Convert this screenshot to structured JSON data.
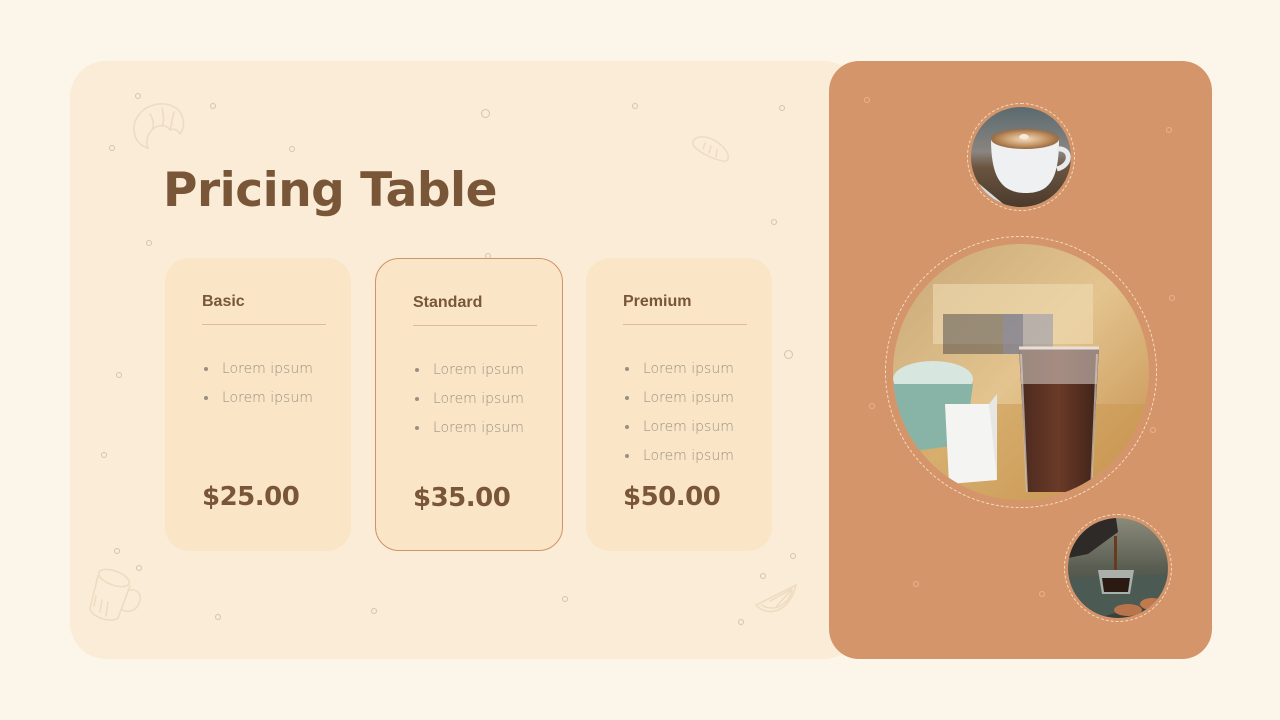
{
  "slide": {
    "title": "Pricing Table",
    "colors": {
      "background": "#fcf6ea",
      "left_panel": "#faecd6",
      "right_panel": "#d4956a",
      "card": "#fae6c6",
      "accent_border": "#cf9468",
      "heading_text": "#7a5638",
      "body_text": "#9a9082"
    }
  },
  "plans": [
    {
      "name": "Basic",
      "features": [
        "Lorem ipsum",
        "Lorem ipsum"
      ],
      "price": "$25.00",
      "featured": false
    },
    {
      "name": "Standard",
      "features": [
        "Lorem ipsum",
        "Lorem ipsum",
        "Lorem ipsum"
      ],
      "price": "$35.00",
      "featured": true
    },
    {
      "name": "Premium",
      "features": [
        "Lorem ipsum",
        "Lorem ipsum",
        "Lorem ipsum",
        "Lorem ipsum"
      ],
      "price": "$50.00",
      "featured": false
    }
  ],
  "photos": [
    {
      "subject": "latte-art-cup"
    },
    {
      "subject": "iced-chocolate-drink"
    },
    {
      "subject": "espresso-pour"
    }
  ],
  "decorations": [
    "croissant-icon",
    "bread-icon",
    "mug-icon",
    "lemon-slice-icon"
  ]
}
